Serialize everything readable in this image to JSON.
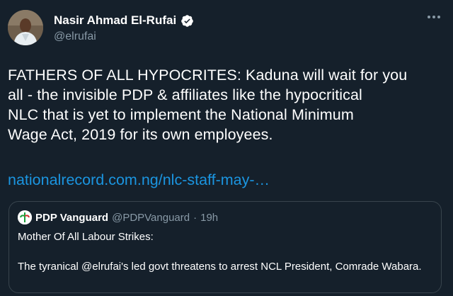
{
  "author": {
    "name": "Nasir Ahmad El-Rufai",
    "handle": "@elrufai",
    "verified": true,
    "avatar_icon": "profile-photo"
  },
  "tweet": {
    "text": "FATHERS OF ALL HYPOCRITES: Kaduna will wait for you\nall - the invisible PDP & affiliates like the hypocritical\nNLC that is yet to implement the National Minimum\nWage Act, 2019 for its own employees.",
    "link": "nationalrecord.com.ng/nlc-staff-may-…"
  },
  "quoted_tweet": {
    "name": "PDP Vanguard",
    "handle": "@PDPVanguard",
    "separator": "·",
    "time": "19h",
    "line1": "Mother Of All Labour Strikes:",
    "line2": "The tyranical @elrufai's led govt threatens to arrest NCL President, Comrade Wabara."
  },
  "colors": {
    "background": "#15202b",
    "text": "#ffffff",
    "secondary": "#8899a6",
    "link": "#1b95e0",
    "border": "#38444d",
    "verified": "#ffffff"
  }
}
